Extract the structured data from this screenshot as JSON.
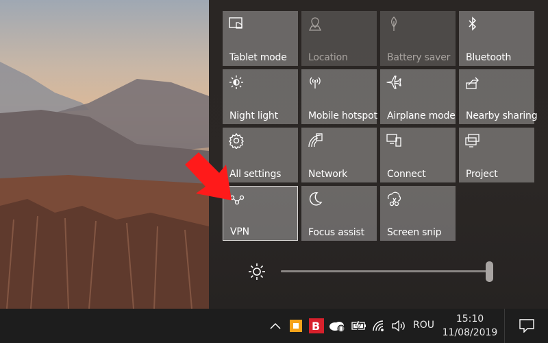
{
  "quick_actions": [
    {
      "label": "Tablet mode",
      "icon": "tablet-mode-icon",
      "state": "on"
    },
    {
      "label": "Location",
      "icon": "location-icon",
      "state": "off"
    },
    {
      "label": "Battery saver",
      "icon": "battery-saver-icon",
      "state": "off"
    },
    {
      "label": "Bluetooth",
      "icon": "bluetooth-icon",
      "state": "on"
    },
    {
      "label": "Night light",
      "icon": "night-light-icon",
      "state": "on"
    },
    {
      "label": "Mobile hotspot",
      "icon": "mobile-hotspot-icon",
      "state": "on"
    },
    {
      "label": "Airplane mode",
      "icon": "airplane-icon",
      "state": "on"
    },
    {
      "label": "Nearby sharing",
      "icon": "nearby-sharing-icon",
      "state": "on"
    },
    {
      "label": "All settings",
      "icon": "gear-icon",
      "state": "on"
    },
    {
      "label": "Network",
      "icon": "network-icon",
      "state": "on"
    },
    {
      "label": "Connect",
      "icon": "connect-icon",
      "state": "on"
    },
    {
      "label": "Project",
      "icon": "project-icon",
      "state": "on"
    },
    {
      "label": "VPN",
      "icon": "vpn-icon",
      "state": "focused"
    },
    {
      "label": "Focus assist",
      "icon": "moon-icon",
      "state": "on"
    },
    {
      "label": "Screen snip",
      "icon": "screen-snip-icon",
      "state": "on"
    }
  ],
  "brightness": {
    "icon": "brightness-icon",
    "level": 100
  },
  "taskbar": {
    "tray_icons": [
      "chevron-up-icon",
      "orange-app-icon",
      "bitdefender-icon",
      "onedrive-icon",
      "battery-icon",
      "wifi-icon",
      "volume-icon"
    ],
    "language": "ROU",
    "time": "15:10",
    "date": "11/08/2019",
    "notification_icon": "notification-icon"
  },
  "colors": {
    "annotation_arrow": "#ff1a1a",
    "app_orange": "#f5a31a",
    "bitdefender_red": "#d8212c"
  }
}
